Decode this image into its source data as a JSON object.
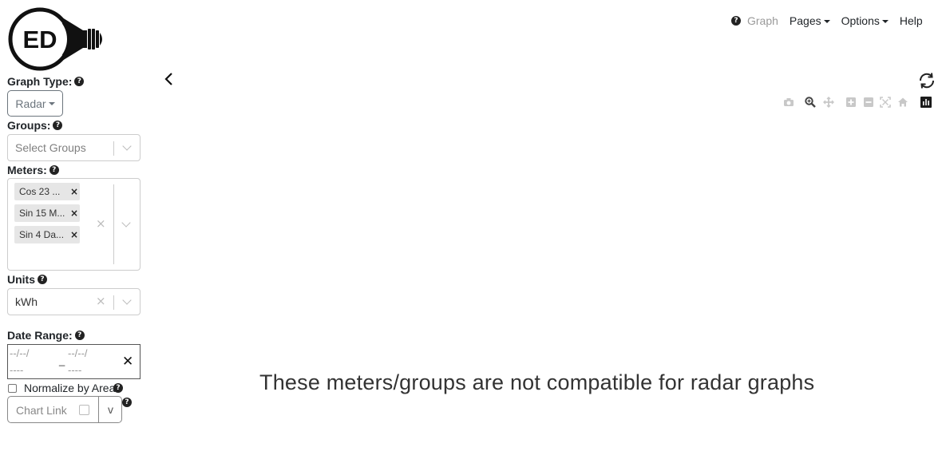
{
  "logo": {
    "text": "ED"
  },
  "nav": {
    "graph_label": "Graph",
    "pages_label": "Pages",
    "options_label": "Options",
    "help_label": "Help"
  },
  "sidebar": {
    "graph_type_label": "Graph Type:",
    "graph_type_value": "Radar",
    "groups_label": "Groups:",
    "groups_placeholder": "Select Groups",
    "meters_label": "Meters:",
    "meters": [
      {
        "label": "Cos 23 ..."
      },
      {
        "label": "Sin 15 M..."
      },
      {
        "label": "Sin 4 Da..."
      }
    ],
    "units_label": "Units",
    "units_value": "kWh",
    "date_range_label": "Date Range:",
    "date_start": "--/--/",
    "date_start_year": "----",
    "date_sep": "_",
    "date_end": "--/--/",
    "date_end_year": "----",
    "normalize_label": "Normalize by Area",
    "chart_link_label": "Chart Link",
    "chart_link_toggle": "v"
  },
  "main": {
    "message": "These meters/groups are not compatible for radar graphs"
  },
  "icons": {
    "help": "?",
    "clear": "×",
    "close": "✕"
  },
  "colors": {
    "text": "#212529",
    "muted": "#9a9a9a",
    "border": "#cccccc"
  }
}
